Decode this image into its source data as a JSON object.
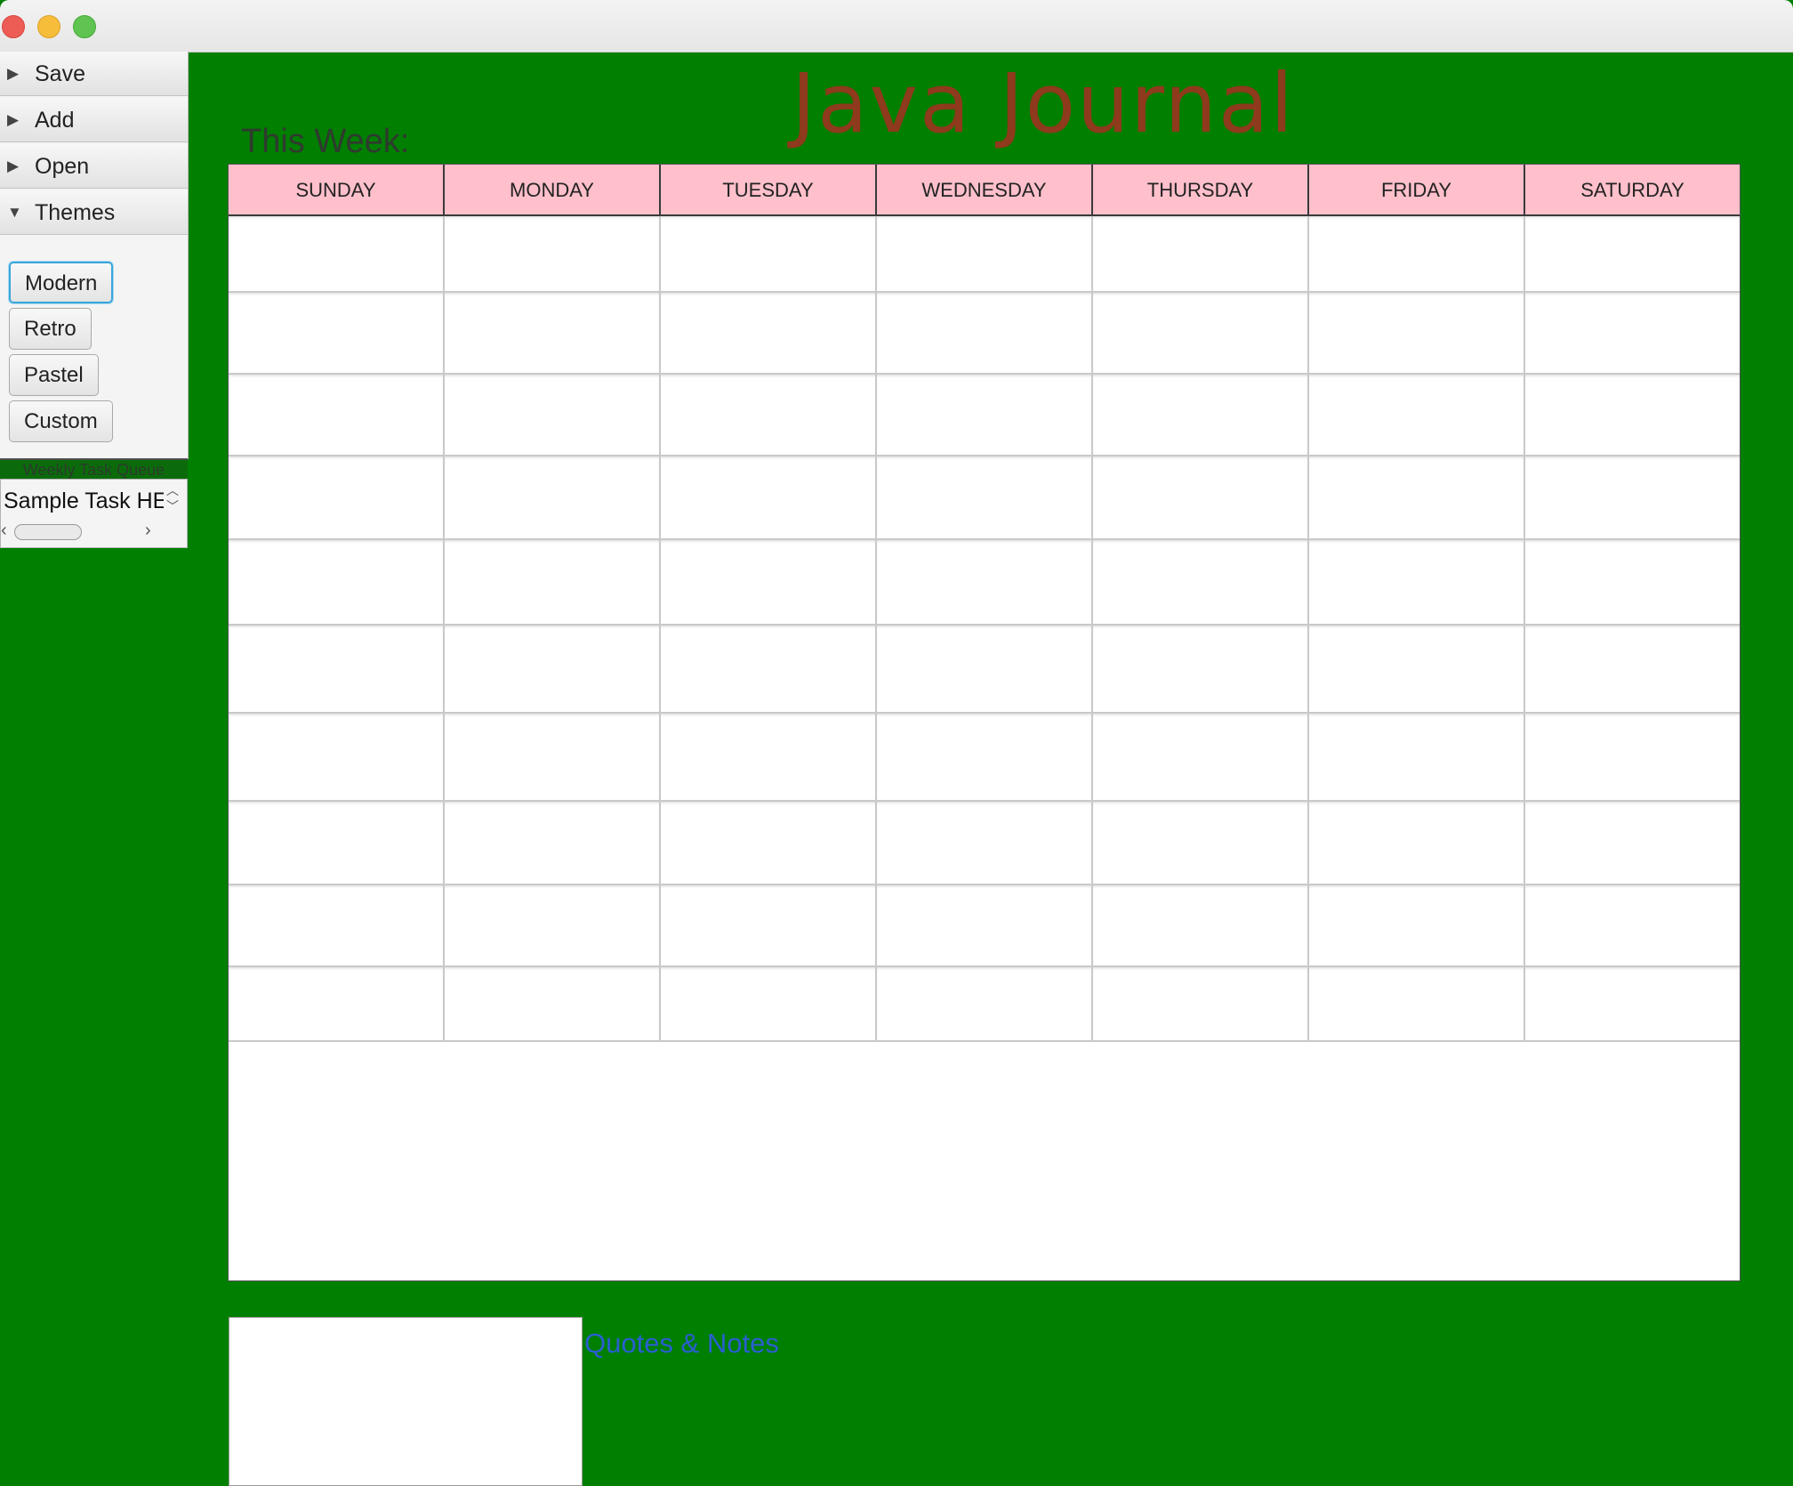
{
  "window": {
    "title": ""
  },
  "sidebar": {
    "panes": [
      {
        "label": "Save",
        "expanded": false
      },
      {
        "label": "Add",
        "expanded": false
      },
      {
        "label": "Open",
        "expanded": false
      },
      {
        "label": "Themes",
        "expanded": true
      }
    ],
    "themes": {
      "buttons": [
        "Modern",
        "Retro",
        "Pastel",
        "Custom"
      ],
      "focused": "Modern"
    },
    "queue": {
      "label": "Weekly Task Queue",
      "value": "Sample Task HERE"
    }
  },
  "header": {
    "title": "Java Journal",
    "week_label": "This Week:"
  },
  "calendar": {
    "days": [
      "SUNDAY",
      "MONDAY",
      "TUESDAY",
      "WEDNESDAY",
      "THURSDAY",
      "FRIDAY",
      "SATURDAY"
    ],
    "row_count": 10
  },
  "notes": {
    "label": "Quotes & Notes"
  },
  "colors": {
    "background": "#007f00",
    "title": "#8e3a1c",
    "header_fill": "#ffc0cb",
    "notes_label": "#2a5fd0",
    "focus_ring": "#3aa6d9"
  }
}
